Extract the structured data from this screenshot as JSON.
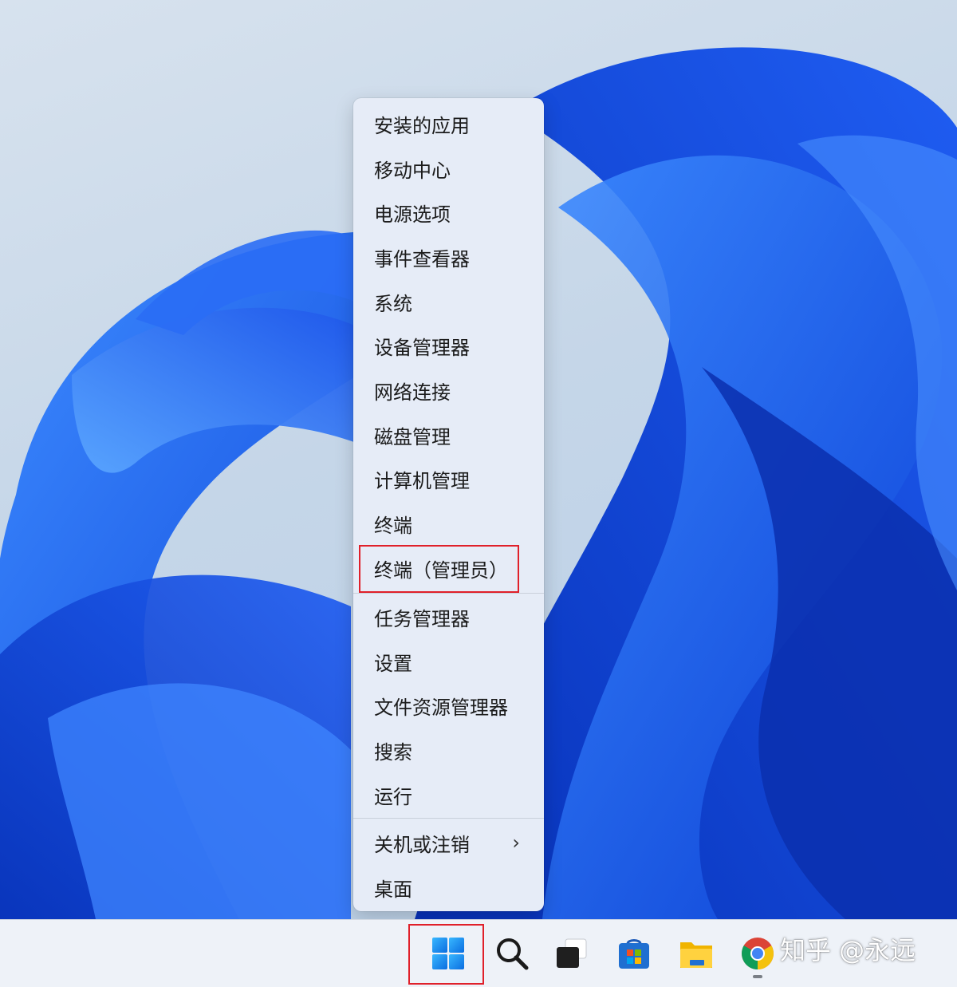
{
  "context_menu": {
    "items": [
      {
        "label": "安装的应用"
      },
      {
        "label": "移动中心"
      },
      {
        "label": "电源选项"
      },
      {
        "label": "事件查看器"
      },
      {
        "label": "系统"
      },
      {
        "label": "设备管理器"
      },
      {
        "label": "网络连接"
      },
      {
        "label": "磁盘管理"
      },
      {
        "label": "计算机管理"
      },
      {
        "label": "终端"
      },
      {
        "label": "终端（管理员）",
        "highlighted": true
      },
      {
        "label": "任务管理器"
      },
      {
        "label": "设置"
      },
      {
        "label": "文件资源管理器"
      },
      {
        "label": "搜索"
      },
      {
        "label": "运行"
      },
      {
        "label": "关机或注销",
        "has_submenu": true
      },
      {
        "label": "桌面"
      }
    ],
    "submenu_chevron": "›"
  },
  "taskbar": {
    "icons": [
      "windows-start-icon",
      "search-icon",
      "task-view-icon",
      "microsoft-store-icon",
      "file-explorer-icon",
      "chrome-icon"
    ],
    "watermark": "知乎 @永远"
  },
  "colors": {
    "highlight_border": "#e0202a",
    "menu_background": "#e6ecf7",
    "taskbar_background": "#eef2f8"
  }
}
